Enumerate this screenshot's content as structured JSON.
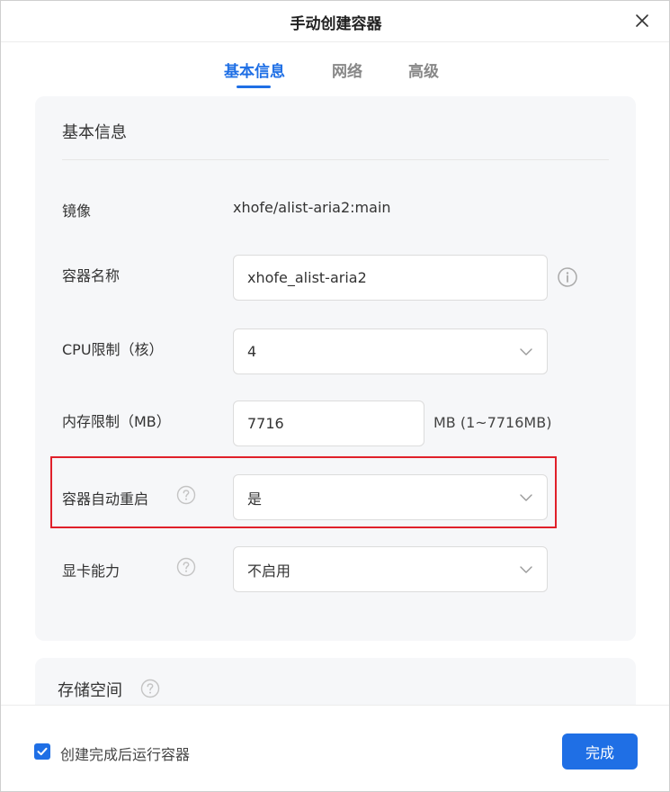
{
  "dialog": {
    "title": "手动创建容器"
  },
  "tabs": [
    {
      "label": "基本信息",
      "active": true
    },
    {
      "label": "网络",
      "active": false
    },
    {
      "label": "高级",
      "active": false
    }
  ],
  "basic_section": {
    "title": "基本信息",
    "image_label": "镜像",
    "image_value": "xhofe/alist-aria2:main",
    "name_label": "容器名称",
    "name_value": "xhofe_alist-aria2",
    "cpu_label": "CPU限制（核）",
    "cpu_value": "4",
    "memory_label": "内存限制（MB）",
    "memory_value": "7716",
    "memory_suffix": "MB (1~7716MB)",
    "restart_label": "容器自动重启",
    "restart_value": "是",
    "gpu_label": "显卡能力",
    "gpu_value": "不启用"
  },
  "storage_section": {
    "title": "存储空间"
  },
  "footer": {
    "run_after_create_label": "创建完成后运行容器",
    "run_after_create_checked": true,
    "done_label": "完成"
  },
  "colors": {
    "accent": "#1f6fe5",
    "highlight": "#e0202a",
    "card_bg": "#f6f7f9"
  }
}
